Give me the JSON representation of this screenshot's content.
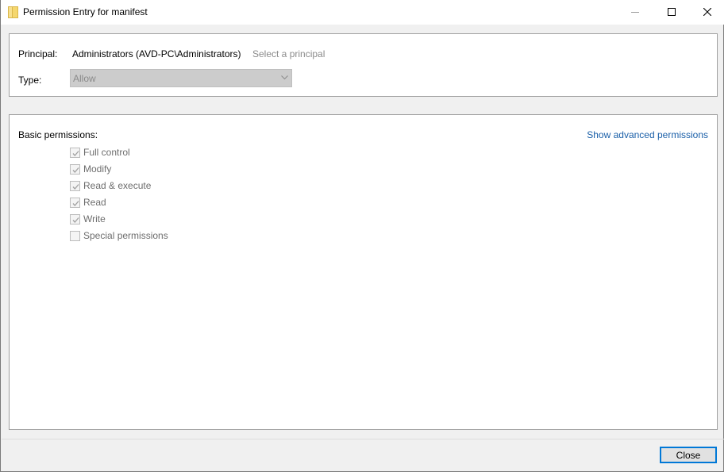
{
  "window": {
    "title": "Permission Entry for manifest"
  },
  "principal": {
    "label": "Principal:",
    "value": "Administrators (AVD-PC\\Administrators)",
    "select_link": "Select a principal"
  },
  "type": {
    "label": "Type:",
    "selected": "Allow"
  },
  "basic_permissions": {
    "heading": "Basic permissions:",
    "advanced_link": "Show advanced permissions",
    "items": [
      {
        "label": "Full control",
        "checked": true
      },
      {
        "label": "Modify",
        "checked": true
      },
      {
        "label": "Read & execute",
        "checked": true
      },
      {
        "label": "Read",
        "checked": true
      },
      {
        "label": "Write",
        "checked": true
      },
      {
        "label": "Special permissions",
        "checked": false
      }
    ]
  },
  "footer": {
    "close_label": "Close"
  },
  "colors": {
    "link": "#1a5fa8",
    "button_border": "#0078d7",
    "folder_icon": "#f5d76e"
  }
}
